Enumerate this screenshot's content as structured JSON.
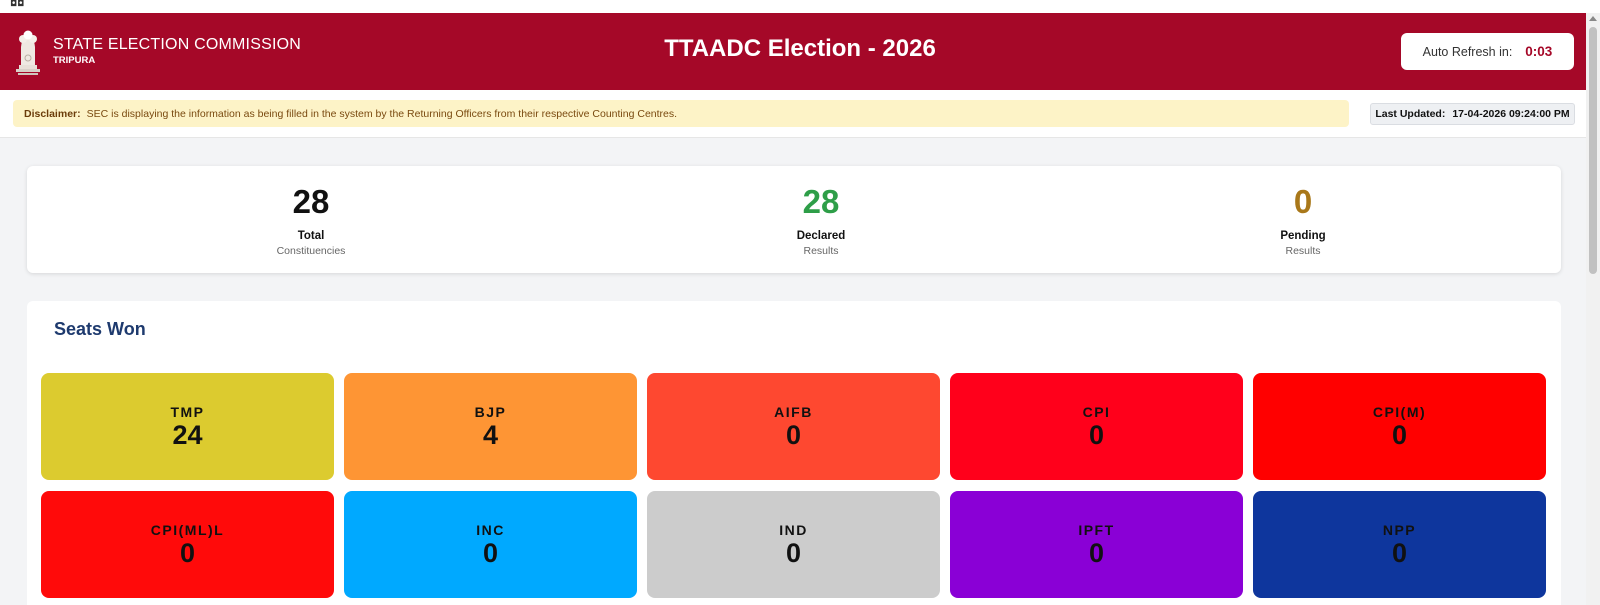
{
  "window": {
    "corner_glyph": "◘◘"
  },
  "header": {
    "org_name": "STATE ELECTION COMMISSION",
    "org_state": "TRIPURA",
    "emblem_icon": "ashoka-emblem-icon",
    "title": "TTAADC Election - 2026",
    "auto_refresh_label": "Auto Refresh in:",
    "auto_refresh_timer": "0:03",
    "colors": {
      "banner": "#a50828",
      "timer": "#a50828"
    }
  },
  "notice": {
    "disclaimer_label": "Disclaimer:",
    "disclaimer_text": "SEC is displaying the information as being filled in the system by the Returning Officers from their respective Counting Centres.",
    "last_updated_label": "Last Updated:",
    "last_updated_value": "17-04-2026 09:24:00 PM"
  },
  "stats": {
    "total": {
      "value": "28",
      "label": "Total",
      "sub": "Constituencies",
      "color": "#111111"
    },
    "declared": {
      "value": "28",
      "label": "Declared",
      "sub": "Results",
      "color": "#2e9e48"
    },
    "pending": {
      "value": "0",
      "label": "Pending",
      "sub": "Results",
      "color": "#a9781a"
    }
  },
  "seats": {
    "title": "Seats Won",
    "parties": [
      {
        "abbr": "TMP",
        "seats": "24",
        "color": "#dccb2f"
      },
      {
        "abbr": "BJP",
        "seats": "4",
        "color": "#fe9534"
      },
      {
        "abbr": "AIFB",
        "seats": "0",
        "color": "#fe4830"
      },
      {
        "abbr": "CPI",
        "seats": "0",
        "color": "#ff001b"
      },
      {
        "abbr": "CPI(M)",
        "seats": "0",
        "color": "#ff0000"
      },
      {
        "abbr": "CPI(ML)L",
        "seats": "0",
        "color": "#ff0a0a"
      },
      {
        "abbr": "INC",
        "seats": "0",
        "color": "#00a9ff"
      },
      {
        "abbr": "IND",
        "seats": "0",
        "color": "#cccccc"
      },
      {
        "abbr": "IPFT",
        "seats": "0",
        "color": "#8a00d6"
      },
      {
        "abbr": "NPP",
        "seats": "0",
        "color": "#0e369d"
      }
    ]
  }
}
